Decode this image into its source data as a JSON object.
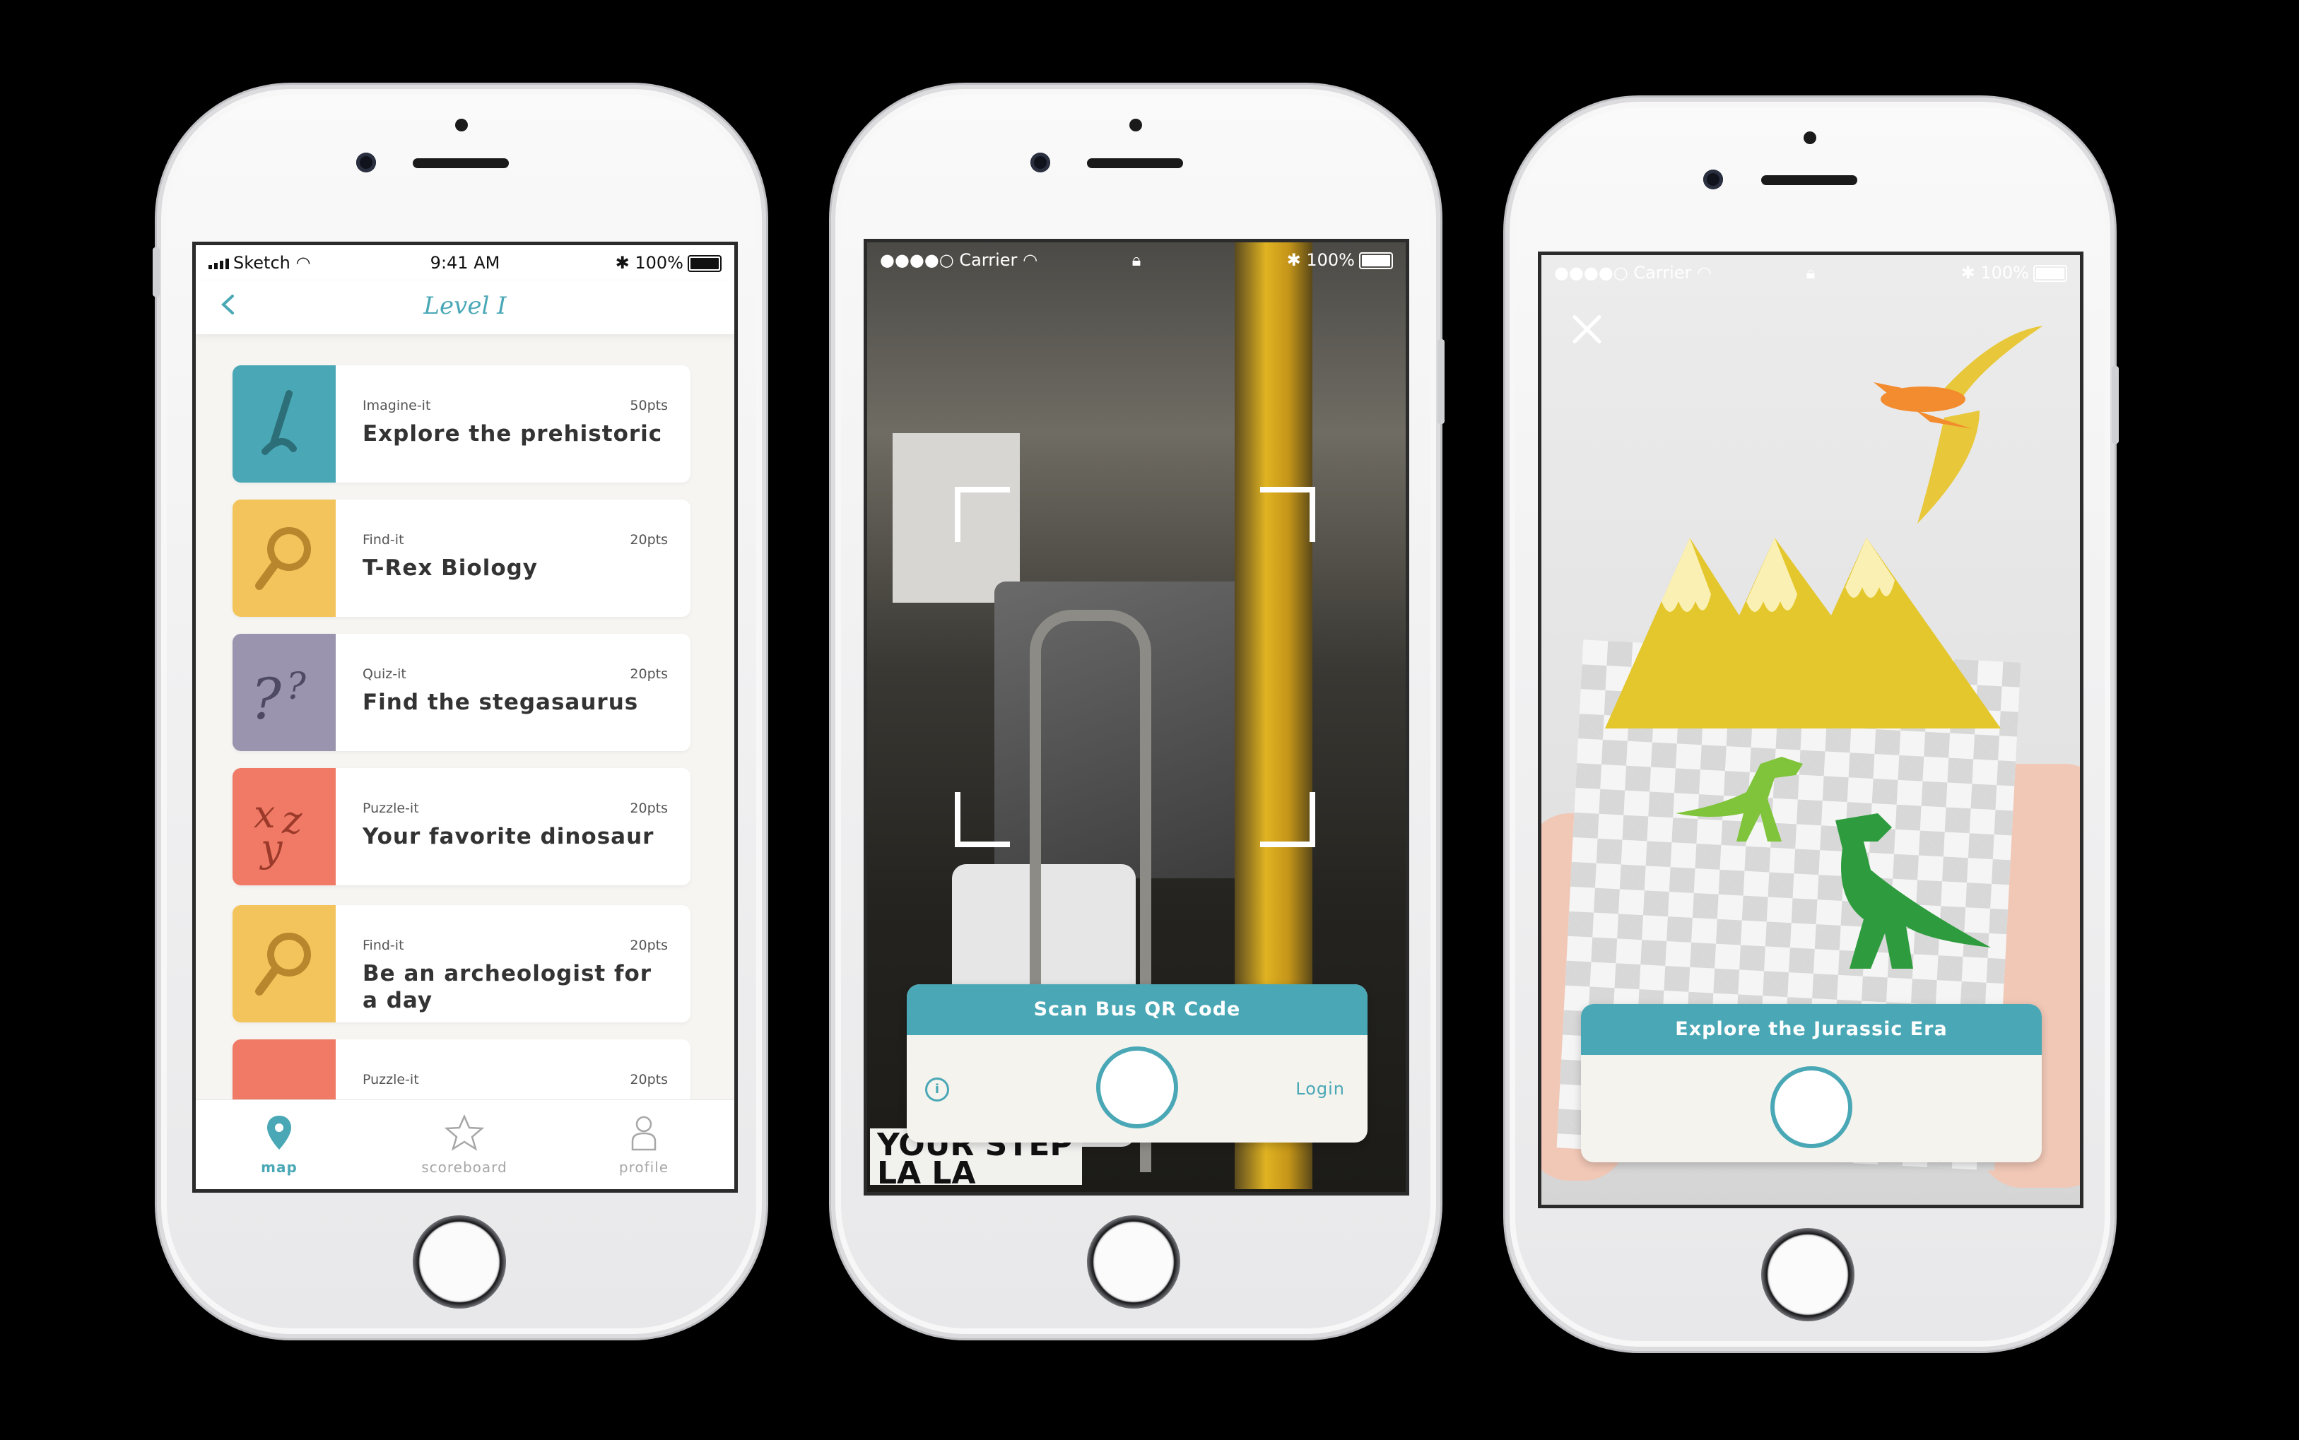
{
  "colors": {
    "teal": "#4aa8b6",
    "mustard": "#f3c45b",
    "lavender": "#9a94ae",
    "coral": "#f07a66",
    "teal_tile": "#4aa8b6"
  },
  "screen1": {
    "status": {
      "carrier": "Sketch",
      "time": "9:41 AM",
      "battery": "100%"
    },
    "nav": {
      "title": "Level I",
      "back_icon": "chevron-left-icon"
    },
    "cards": [
      {
        "category": "Imagine-it",
        "points": "50pts",
        "title": "Explore the prehistoric",
        "tile_color": "#4aa8b6",
        "icon": "pencil-icon"
      },
      {
        "category": "Find-it",
        "points": "20pts",
        "title": "T-Rex Biology",
        "tile_color": "#f3c45b",
        "icon": "magnifier-icon"
      },
      {
        "category": "Quiz-it",
        "points": "20pts",
        "title": "Find the stegasaurus",
        "tile_color": "#9a94ae",
        "icon": "question-marks-icon"
      },
      {
        "category": "Puzzle-it",
        "points": "20pts",
        "title": "Your favorite dinosaur",
        "tile_color": "#f07a66",
        "icon": "xyz-icon"
      },
      {
        "category": "Find-it",
        "points": "20pts",
        "title": "Be an archeologist for a day",
        "tile_color": "#f3c45b",
        "icon": "magnifier-icon"
      },
      {
        "category": "Puzzle-it",
        "points": "20pts",
        "title": "",
        "tile_color": "#f07a66",
        "icon": "xyz-icon"
      }
    ],
    "tabs": [
      {
        "label": "map",
        "icon": "map-pin-icon",
        "active": true
      },
      {
        "label": "scoreboard",
        "icon": "star-icon",
        "active": false
      },
      {
        "label": "profile",
        "icon": "person-icon",
        "active": false
      }
    ]
  },
  "screen2": {
    "status": {
      "carrier": "Carrier",
      "battery": "100%"
    },
    "panel": {
      "header": "Scan Bus QR Code",
      "info_icon": "info-icon",
      "login": "Login"
    },
    "sign_text": "YOUR STEP LA LA MARCHE"
  },
  "screen3": {
    "status": {
      "carrier": "Carrier",
      "battery": "100%"
    },
    "close_icon": "close-icon",
    "panel": {
      "header": "Explore the Jurassic Era"
    }
  }
}
